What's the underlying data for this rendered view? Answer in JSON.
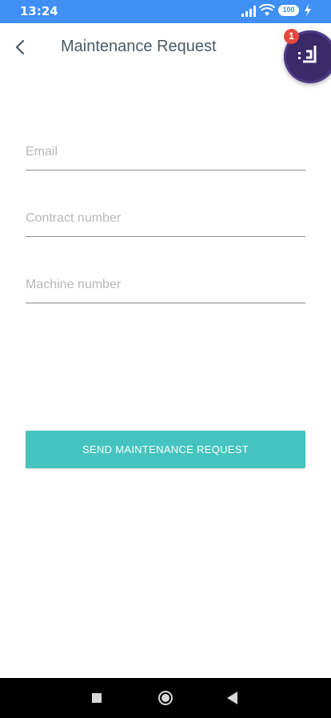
{
  "status_bar": {
    "time": "13:24",
    "battery": "100"
  },
  "app_bar": {
    "title": "Maintenance Request"
  },
  "notification": {
    "count": "1"
  },
  "form": {
    "email_placeholder": "Email",
    "contract_placeholder": "Contract number",
    "machine_placeholder": "Machine number",
    "submit_label": "SEND MAINTENANCE REQUEST"
  },
  "colors": {
    "status_bar": "#3f8ff5",
    "accent_button": "#45c4bf",
    "badge": "#e5483d",
    "title_text": "#4a5a66"
  }
}
